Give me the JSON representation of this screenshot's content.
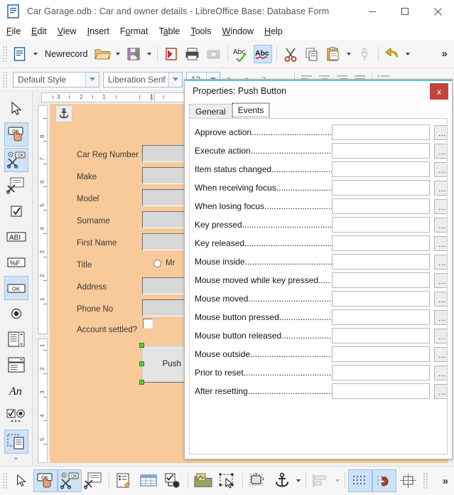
{
  "window": {
    "title": "Car Garage.odb : Car and owner details - LibreOffice Base: Database Form",
    "doc_icon": "document-icon",
    "minimize": "─",
    "maximize": "□",
    "close": "✕"
  },
  "menubar": {
    "items": [
      {
        "label": "File",
        "accel": "F"
      },
      {
        "label": "Edit",
        "accel": "E"
      },
      {
        "label": "View",
        "accel": "V"
      },
      {
        "label": "Insert",
        "accel": "I"
      },
      {
        "label": "Format",
        "accel": "o"
      },
      {
        "label": "Table",
        "accel": "a"
      },
      {
        "label": "Tools",
        "accel": "T"
      },
      {
        "label": "Window",
        "accel": "W"
      },
      {
        "label": "Help",
        "accel": "H"
      }
    ]
  },
  "toolbar": {
    "newrecord_label": "Newrecord",
    "overflow": "»",
    "items": [
      {
        "name": "new-document-icon",
        "kind": "icon"
      },
      {
        "name": "new-dropdown-caret",
        "kind": "caret"
      },
      {
        "name": "newrecord-label",
        "kind": "label"
      },
      {
        "name": "open-folder-icon",
        "kind": "icon"
      },
      {
        "name": "open-dropdown-caret",
        "kind": "caret"
      },
      {
        "name": "save-icon",
        "kind": "icon"
      },
      {
        "name": "save-dropdown-caret",
        "kind": "caret"
      },
      {
        "name": "export-pdf-icon",
        "kind": "icon"
      },
      {
        "name": "print-icon",
        "kind": "icon"
      },
      {
        "name": "print-preview-icon",
        "kind": "icon"
      },
      {
        "name": "spelling-icon",
        "kind": "icon"
      },
      {
        "name": "autospellcheck-icon",
        "kind": "icon",
        "active": true
      },
      {
        "name": "cut-icon",
        "kind": "icon"
      },
      {
        "name": "copy-icon",
        "kind": "icon"
      },
      {
        "name": "paste-icon",
        "kind": "icon"
      },
      {
        "name": "paste-dropdown-caret",
        "kind": "caret"
      },
      {
        "name": "clone-formatting-icon",
        "kind": "icon"
      },
      {
        "name": "undo-icon",
        "kind": "icon"
      },
      {
        "name": "undo-dropdown-caret",
        "kind": "caret"
      }
    ]
  },
  "formatbar": {
    "paragraph_style": "Default Style",
    "font_name": "Liberation Serif",
    "font_size": "12"
  },
  "palette": {
    "items": [
      {
        "name": "select-tool",
        "icon": "arrow-cursor-icon",
        "active": false
      },
      {
        "name": "design-mode-toggle",
        "icon": "push-button-hand-icon",
        "active": true
      },
      {
        "name": "toggle-form-control-wizards",
        "icon": "wizard-wand-icon",
        "active": true
      },
      {
        "name": "form-design-tools",
        "icon": "form-design-icon",
        "active": false
      },
      {
        "name": "check-box-control",
        "icon": "checkbox-icon",
        "active": false
      },
      {
        "name": "text-box-control",
        "icon": "text-box-icon",
        "active": false
      },
      {
        "name": "formatted-field-control",
        "icon": "formatted-field-icon",
        "active": false
      },
      {
        "name": "push-button-control",
        "icon": "push-button-icon",
        "active": true
      },
      {
        "name": "option-button-control",
        "icon": "radio-button-icon",
        "active": false
      },
      {
        "name": "list-box-control",
        "icon": "list-box-icon",
        "active": false
      },
      {
        "name": "combo-box-control",
        "icon": "combo-box-icon",
        "active": false
      },
      {
        "name": "label-field-control",
        "icon": "label-field-icon",
        "active": false
      },
      {
        "name": "more-controls",
        "icon": "more-controls-icon",
        "active": false
      },
      {
        "name": "form-design-panel",
        "icon": "form-design-panel-icon",
        "active": true
      },
      {
        "name": "palette-expand",
        "icon": "chevron-double-down-icon",
        "active": false
      }
    ],
    "expand_glyph": "ˇ"
  },
  "rulers": {
    "horizontal_ticks": [
      "3",
      "2",
      "1",
      "1"
    ],
    "vertical_ticks": [
      "8",
      "7",
      "6",
      "5",
      "4",
      "3",
      "2",
      "1",
      "1",
      "2",
      "3",
      "4",
      "5"
    ],
    "unit": "inch"
  },
  "form": {
    "anchor_icon": "anchor-icon",
    "background_color": "#f8c999",
    "fields": [
      {
        "label": "Car Reg Number",
        "control": "text-box"
      },
      {
        "label": "Make",
        "control": "text-box"
      },
      {
        "label": "Model",
        "control": "text-box"
      },
      {
        "label": "Surname",
        "control": "text-box"
      },
      {
        "label": "First Name",
        "control": "text-box"
      },
      {
        "label": "Title",
        "control": "radio",
        "option_label": "Mr"
      },
      {
        "label": "Address",
        "control": "text-box"
      },
      {
        "label": "Phone No",
        "control": "text-box"
      },
      {
        "label": "Account settled?",
        "control": "check-box"
      }
    ],
    "push_button": {
      "label": "Push Button",
      "selected": true
    }
  },
  "dialog": {
    "title": "Properties: Push Button",
    "close_label": "x",
    "tabs": [
      {
        "label": "General",
        "active": false
      },
      {
        "label": "Events",
        "active": true
      }
    ],
    "browse_label": "...",
    "events": [
      {
        "label": "Approve action...................................",
        "value": ""
      },
      {
        "label": "Execute action....................................",
        "value": ""
      },
      {
        "label": "Item status changed............................",
        "value": ""
      },
      {
        "label": "When receiving focus..........................",
        "value": ""
      },
      {
        "label": "When losing focus...............................",
        "value": ""
      },
      {
        "label": "Key pressed..........................................",
        "value": ""
      },
      {
        "label": "Key released........................................",
        "value": ""
      },
      {
        "label": "Mouse inside........................................",
        "value": ""
      },
      {
        "label": "Mouse moved while key pressed.....",
        "value": ""
      },
      {
        "label": "Mouse moved........................................",
        "value": ""
      },
      {
        "label": "Mouse button pressed........................",
        "value": ""
      },
      {
        "label": "Mouse button released.......................",
        "value": ""
      },
      {
        "label": "Mouse outside......................................",
        "value": ""
      },
      {
        "label": "Prior to reset.......................................",
        "value": ""
      },
      {
        "label": "After resetting.....................................",
        "value": ""
      }
    ]
  },
  "bottombar": {
    "overflow": "»",
    "items": [
      {
        "name": "select-tool",
        "icon": "arrow-cursor-icon",
        "active": false
      },
      {
        "name": "design-mode-toggle",
        "icon": "push-button-hand-icon",
        "active": true
      },
      {
        "name": "toggle-form-control-wizards",
        "icon": "wizard-wand-icon",
        "active": true
      },
      {
        "name": "form-design-tools",
        "icon": "form-design-icon",
        "active": false
      },
      {
        "name": "control-properties",
        "icon": "control-properties-icon",
        "active": false
      },
      {
        "name": "form-properties",
        "icon": "form-properties-table-icon",
        "active": false
      },
      {
        "name": "activation-order",
        "icon": "activation-order-icon",
        "active": false
      },
      {
        "name": "open-in-design-mode",
        "icon": "open-design-mode-icon",
        "active": false
      },
      {
        "name": "select-objects",
        "icon": "select-objects-icon",
        "active": false
      },
      {
        "name": "position-and-size",
        "icon": "position-size-icon",
        "active": false
      },
      {
        "name": "anchor-menu",
        "icon": "anchor-icon",
        "active": false
      },
      {
        "name": "anchor-caret",
        "icon": "caret-down-icon",
        "active": false
      },
      {
        "name": "align-objects",
        "icon": "align-objects-icon",
        "active": false
      },
      {
        "name": "align-caret",
        "icon": "caret-down-icon",
        "active": false
      },
      {
        "name": "display-grid",
        "icon": "grid-dots-icon",
        "active": true
      },
      {
        "name": "snap-to-grid",
        "icon": "snap-grid-icon",
        "active": true
      },
      {
        "name": "helplines-while-moving",
        "icon": "helplines-icon",
        "active": false
      }
    ]
  }
}
